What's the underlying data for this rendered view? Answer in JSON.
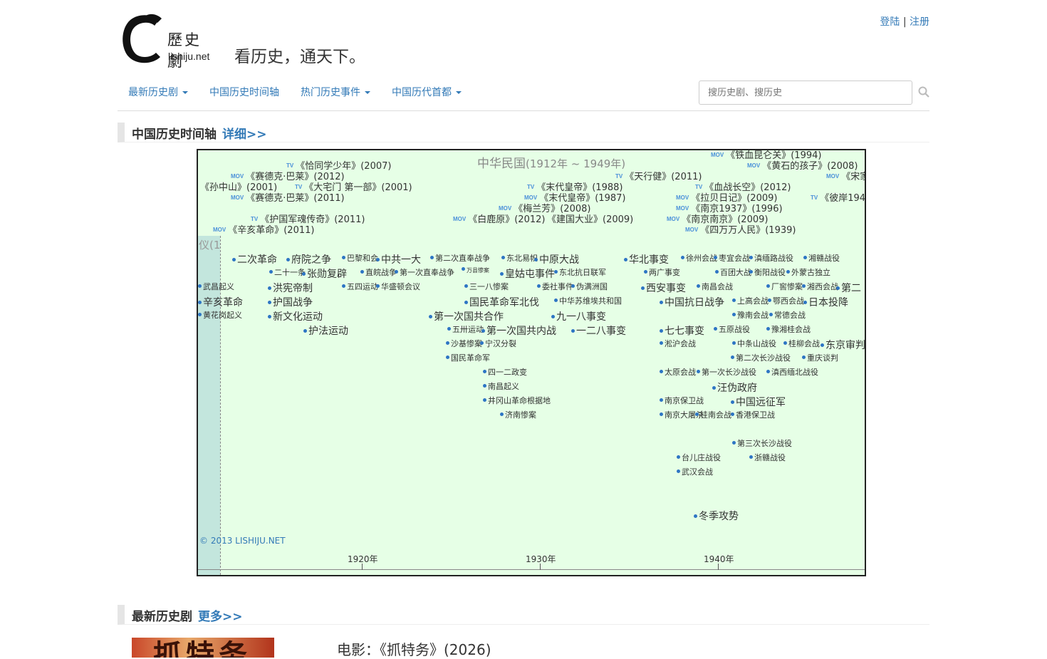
{
  "header": {
    "logo_cn": "歷史劇",
    "logo_en": "lishiju.net",
    "slogan": "看历史，通天下。",
    "login": "登陆",
    "separator": "|",
    "register": "注册"
  },
  "nav": {
    "items": [
      {
        "label": "最新历史剧",
        "dropdown": true
      },
      {
        "label": "中国历史时间轴",
        "dropdown": false
      },
      {
        "label": "热门历史事件",
        "dropdown": true
      },
      {
        "label": "中国历代首都",
        "dropdown": true
      }
    ],
    "search_placeholder": "搜历史剧、搜历史",
    "search_icon": "search-icon"
  },
  "timeline_section": {
    "title": "中国历史时间轴",
    "more": "详细>>"
  },
  "timeline": {
    "era": "中华民国",
    "era_range": "(1912年 ~ 1949年)",
    "left_fragment": "仪(1",
    "copyright": "© 2013 LISHIJU.NET",
    "years": [
      "1920年",
      "1930年",
      "1940年"
    ],
    "tag_tv": "TV",
    "tag_mov": "MOV",
    "media": [
      {
        "tag": "TV",
        "title": "《恰同学少年》(2007)"
      },
      {
        "tag": "MOV",
        "title": "《赛德克·巴莱》(2012)"
      },
      {
        "tag": "",
        "title": "《孙中山》(2001)"
      },
      {
        "tag": "TV",
        "title": "《大宅门 第一部》(2001)"
      },
      {
        "tag": "MOV",
        "title": "《赛德克·巴莱》(2011)"
      },
      {
        "tag": "TV",
        "title": "《护国军魂传奇》(2011)"
      },
      {
        "tag": "MOV",
        "title": "《辛亥革命》(2011)"
      },
      {
        "tag": "TV",
        "title": "《末代皇帝》(1988)"
      },
      {
        "tag": "MOV",
        "title": "《末代皇帝》(1987)"
      },
      {
        "tag": "MOV",
        "title": "《梅兰芳》(2008)"
      },
      {
        "tag": "MOV",
        "title": "《白鹿原》(2012)"
      },
      {
        "tag": "",
        "title": "《建国大业》(2009)"
      },
      {
        "tag": "TV",
        "title": "《天行健》(2011)"
      },
      {
        "tag": "MOV",
        "title": "《铁血昆仑关》(1994)"
      },
      {
        "tag": "MOV",
        "title": "《黄石的孩子》(2008)"
      },
      {
        "tag": "TV",
        "title": "《血战长空》(2012)"
      },
      {
        "tag": "MOV",
        "title": "《拉贝日记》(2009)"
      },
      {
        "tag": "MOV",
        "title": "《南京1937》(1996)"
      },
      {
        "tag": "MOV",
        "title": "《南京南京》(2009)"
      },
      {
        "tag": "MOV",
        "title": "《四万万人民》(1939)"
      },
      {
        "tag": "MOV",
        "title": "《宋家"
      },
      {
        "tag": "TV",
        "title": "《彼岸194"
      }
    ],
    "events": [
      {
        "label": "二次革命",
        "size": 1
      },
      {
        "label": "府院之争",
        "size": 1
      },
      {
        "label": "巴黎和会",
        "size": 2
      },
      {
        "label": "中共一大",
        "size": 1
      },
      {
        "label": "第二次直奉战争",
        "size": 2
      },
      {
        "label": "东北易帜",
        "size": 2
      },
      {
        "label": "中原大战",
        "size": 1
      },
      {
        "label": "华北事变",
        "size": 1
      },
      {
        "label": "徐州会战",
        "size": 2
      },
      {
        "label": "枣宜会战",
        "size": 2
      },
      {
        "label": "滇缅路战役",
        "size": 2
      },
      {
        "label": "湘赣战役",
        "size": 2
      },
      {
        "label": "二十一条",
        "size": 2
      },
      {
        "label": "张勋复辟",
        "size": 1
      },
      {
        "label": "直皖战争",
        "size": 2
      },
      {
        "label": "第一次直奉战争",
        "size": 2
      },
      {
        "label": "万县惨案",
        "size": 3
      },
      {
        "label": "皇姑屯事件",
        "size": 1
      },
      {
        "label": "东北抗日联军",
        "size": 2
      },
      {
        "label": "两广事变",
        "size": 2
      },
      {
        "label": "百团大战",
        "size": 2
      },
      {
        "label": "衡阳战役",
        "size": 2
      },
      {
        "label": "外蒙古独立",
        "size": 2
      },
      {
        "label": "武昌起义",
        "size": 2
      },
      {
        "label": "洪宪帝制",
        "size": 1
      },
      {
        "label": "五四运动",
        "size": 2
      },
      {
        "label": "华盛顿会议",
        "size": 2
      },
      {
        "label": "三一八惨案",
        "size": 2
      },
      {
        "label": "委社事件",
        "size": 2
      },
      {
        "label": "伪满洲国",
        "size": 2
      },
      {
        "label": "西安事变",
        "size": 1
      },
      {
        "label": "南昌会战",
        "size": 2
      },
      {
        "label": "厂窖惨案",
        "size": 2
      },
      {
        "label": "湘西会战",
        "size": 2
      },
      {
        "label": "第二",
        "size": 1
      },
      {
        "label": "辛亥革命",
        "size": 1
      },
      {
        "label": "护国战争",
        "size": 1
      },
      {
        "label": "国民革命军北伐",
        "size": 1
      },
      {
        "label": "中华苏维埃共和国",
        "size": 2
      },
      {
        "label": "中国抗日战争",
        "size": 1
      },
      {
        "label": "上高会战",
        "size": 2
      },
      {
        "label": "鄂西会战",
        "size": 2
      },
      {
        "label": "日本投降",
        "size": 1
      },
      {
        "label": "黄花岗起义",
        "size": 2
      },
      {
        "label": "新文化运动",
        "size": 1
      },
      {
        "label": "第一次国共合作",
        "size": 1
      },
      {
        "label": "九一八事变",
        "size": 1
      },
      {
        "label": "豫南会战",
        "size": 2
      },
      {
        "label": "常德会战",
        "size": 2
      },
      {
        "label": "护法运动",
        "size": 1
      },
      {
        "label": "五卅运动",
        "size": 2
      },
      {
        "label": "第一次国共内战",
        "size": 1
      },
      {
        "label": "一二八事变",
        "size": 1
      },
      {
        "label": "七七事变",
        "size": 1
      },
      {
        "label": "五原战役",
        "size": 2
      },
      {
        "label": "豫湘桂会战",
        "size": 2
      },
      {
        "label": "沙基惨案",
        "size": 2
      },
      {
        "label": "宁汉分裂",
        "size": 2
      },
      {
        "label": "淞沪会战",
        "size": 2
      },
      {
        "label": "中条山战役",
        "size": 2
      },
      {
        "label": "桂柳会战",
        "size": 2
      },
      {
        "label": "东京审判",
        "size": 1
      },
      {
        "label": "国民革命军",
        "size": 2
      },
      {
        "label": "第二次长沙战役",
        "size": 2
      },
      {
        "label": "重庆谈判",
        "size": 2
      },
      {
        "label": "四一二政变",
        "size": 2
      },
      {
        "label": "太原会战",
        "size": 2
      },
      {
        "label": "第一次长沙战役",
        "size": 2
      },
      {
        "label": "滇西缅北战役",
        "size": 2
      },
      {
        "label": "南昌起义",
        "size": 2
      },
      {
        "label": "汪伪政府",
        "size": 1
      },
      {
        "label": "井冈山革命根据地",
        "size": 2
      },
      {
        "label": "南京保卫战",
        "size": 2
      },
      {
        "label": "中国远征军",
        "size": 1
      },
      {
        "label": "济南惨案",
        "size": 2
      },
      {
        "label": "南京大屠杀",
        "size": 2
      },
      {
        "label": "桂南会战",
        "size": 2
      },
      {
        "label": "香港保卫战",
        "size": 2
      },
      {
        "label": "第三次长沙战役",
        "size": 2
      },
      {
        "label": "台儿庄战役",
        "size": 2
      },
      {
        "label": "浙赣战役",
        "size": 2
      },
      {
        "label": "武汉会战",
        "size": 2
      },
      {
        "label": "冬季攻势",
        "size": 1
      }
    ]
  },
  "latest_section": {
    "title": "最新历史剧",
    "more": "更多>>",
    "poster_text": "抓特务",
    "first_item": "电影：《抓特务》(2026)"
  }
}
